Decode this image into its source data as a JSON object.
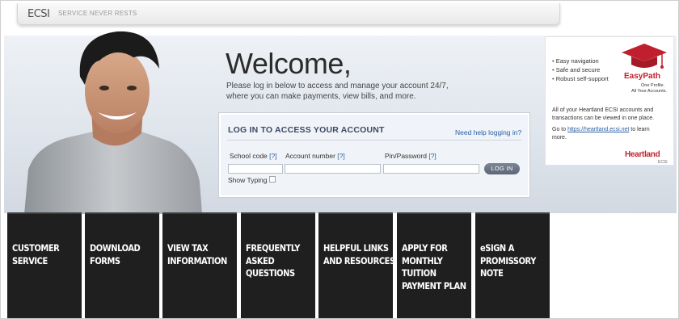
{
  "header": {
    "logo": "ECSI",
    "tagline": "SERVICE NEVER RESTS"
  },
  "welcome": {
    "title": "Welcome,",
    "intro": "Please log in below to access and manage your account 24/7, where you can make payments, view bills, and more."
  },
  "login": {
    "title": "LOG IN TO ACCESS YOUR ACCOUNT",
    "help_link": "Need help logging in?",
    "school_code_label": "School code",
    "account_number_label": "Account number",
    "pin_label": "Pin/Password",
    "help_marker": "[?]",
    "school_code_value": "",
    "account_number_value": "",
    "pin_value": "",
    "login_button": "LOG IN",
    "show_typing": "Show Typing"
  },
  "ad": {
    "bullets": [
      "Easy navigation",
      "Safe and secure",
      "Robust self-support"
    ],
    "brand": "EasyPath",
    "brand_line1": "One Profile.",
    "brand_line2": "All Your Accounts.",
    "body": "All of your Heartland ECSI accounts and transactions can be viewed in one place.",
    "goto_prefix": "Go to ",
    "goto_link": "https://heartland.ecsi.net",
    "goto_suffix": " to learn more.",
    "footer_brand": "Heartland",
    "footer_sub": "ECSI"
  },
  "tiles": [
    {
      "label": "CUSTOMER SERVICE"
    },
    {
      "label": "DOWNLOAD FORMS"
    },
    {
      "label": "VIEW TAX INFORMATION"
    },
    {
      "label": "FREQUENTLY ASKED QUESTIONS"
    },
    {
      "label": "HELPFUL LINKS AND RESOURCES"
    },
    {
      "label": "APPLY FOR MONTHLY TUITION PAYMENT PLAN"
    },
    {
      "label": "eSIGN A PROMISSORY NOTE"
    }
  ],
  "colors": {
    "brand_red": "#c01f2e",
    "link_blue": "#2b5ea6",
    "tile_bg": "#1f1f1f"
  }
}
